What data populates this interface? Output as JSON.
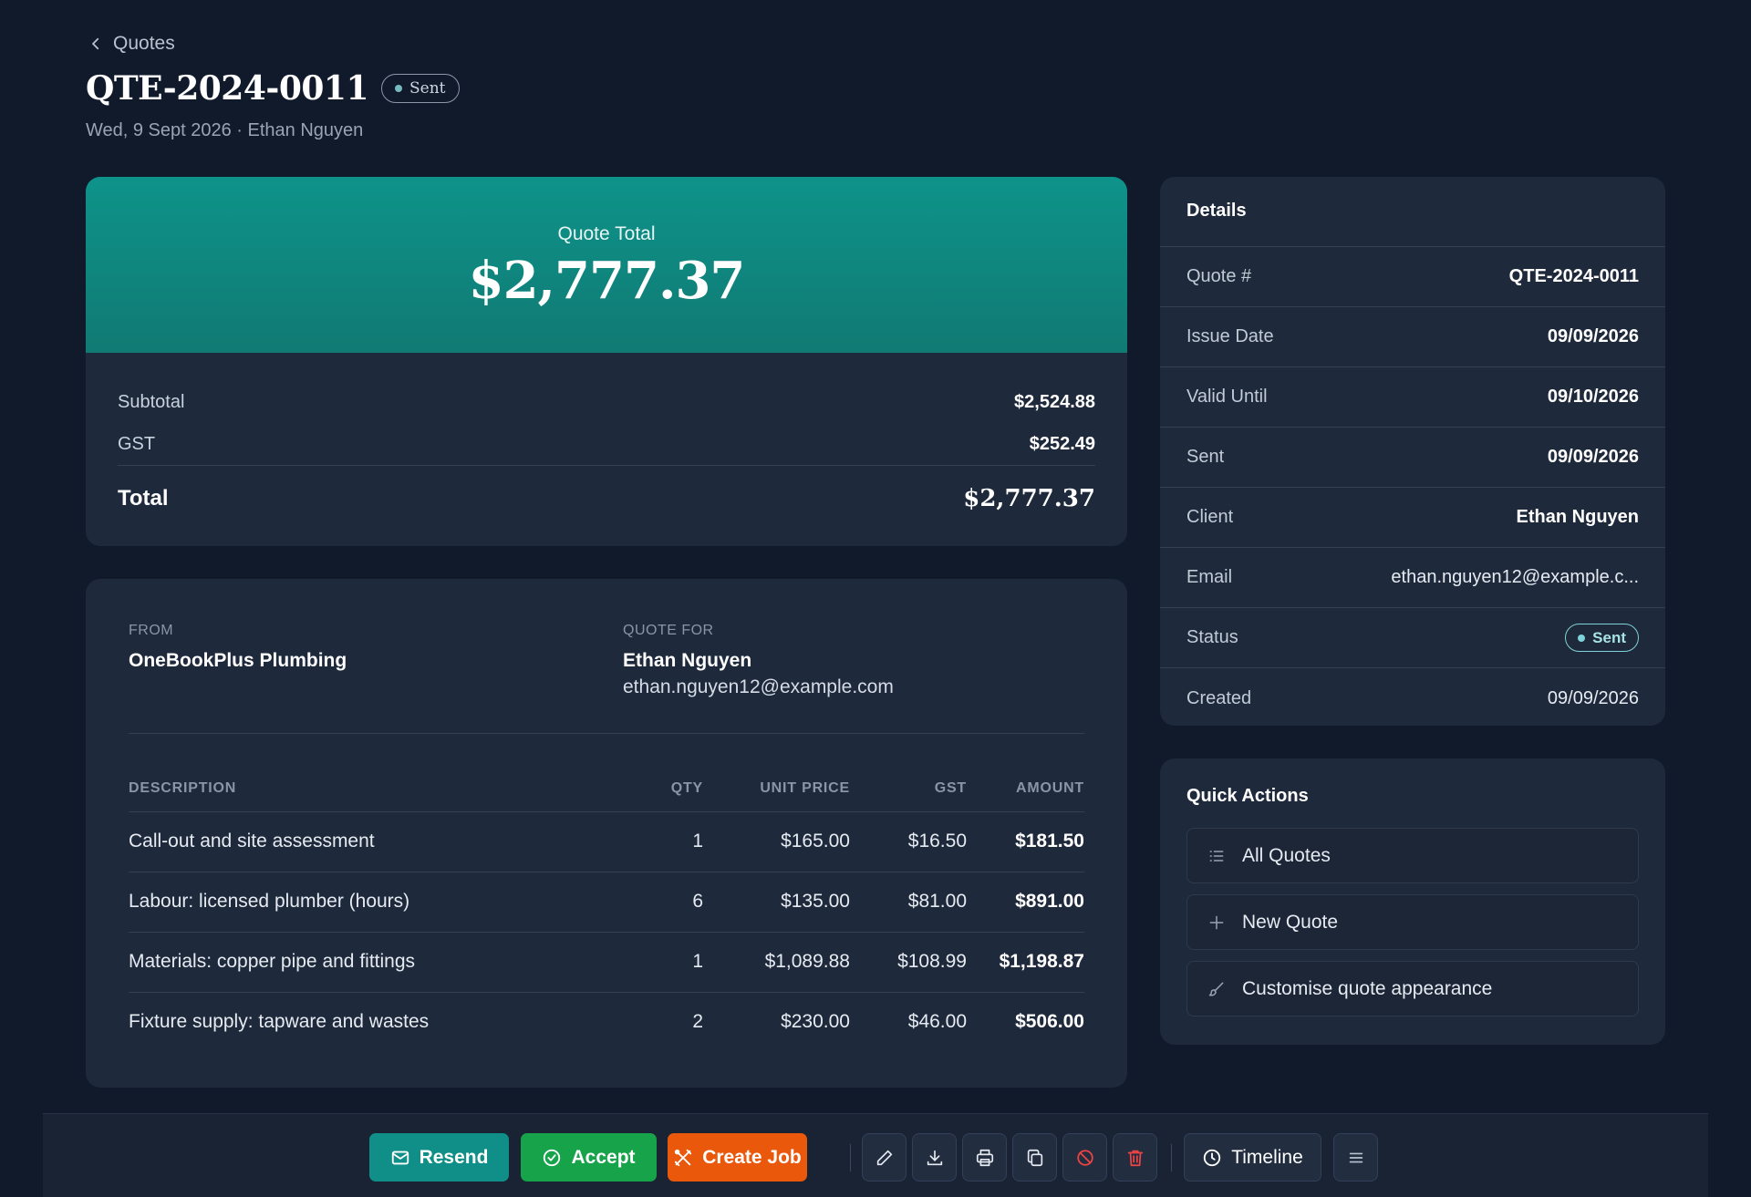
{
  "header": {
    "back_label": "Quotes",
    "title": "QTE-2024-0011",
    "status_badge": "Sent",
    "subtitle": "Wed, 9 Sept 2026 · Ethan Nguyen"
  },
  "total_card": {
    "label": "Quote Total",
    "amount": "$2,777.37",
    "subtotal_label": "Subtotal",
    "subtotal_value": "$2,524.88",
    "gst_label": "GST",
    "gst_value": "$252.49",
    "total_label": "Total",
    "total_value": "$2,777.37"
  },
  "parties": {
    "from_label": "FROM",
    "from_name": "OneBookPlus Plumbing",
    "for_label": "QUOTE FOR",
    "for_name": "Ethan Nguyen",
    "for_email": "ethan.nguyen12@example.com"
  },
  "line_items": {
    "headers": {
      "description": "DESCRIPTION",
      "qty": "QTY",
      "unit_price": "UNIT PRICE",
      "gst": "GST",
      "amount": "AMOUNT"
    },
    "rows": [
      {
        "description": "Call-out and site assessment",
        "qty": "1",
        "unit_price": "$165.00",
        "gst": "$16.50",
        "amount": "$181.50"
      },
      {
        "description": "Labour: licensed plumber (hours)",
        "qty": "6",
        "unit_price": "$135.00",
        "gst": "$81.00",
        "amount": "$891.00"
      },
      {
        "description": "Materials: copper pipe and fittings",
        "qty": "1",
        "unit_price": "$1,089.88",
        "gst": "$108.99",
        "amount": "$1,198.87"
      },
      {
        "description": "Fixture supply: tapware and wastes",
        "qty": "2",
        "unit_price": "$230.00",
        "gst": "$46.00",
        "amount": "$506.00"
      }
    ]
  },
  "details": {
    "title": "Details",
    "rows": [
      {
        "label": "Quote #",
        "value": "QTE-2024-0011"
      },
      {
        "label": "Issue Date",
        "value": "09/09/2026"
      },
      {
        "label": "Valid Until",
        "value": "09/10/2026"
      },
      {
        "label": "Sent",
        "value": "09/09/2026"
      },
      {
        "label": "Client",
        "value": "Ethan Nguyen"
      },
      {
        "label": "Email",
        "value": "ethan.nguyen12@example.c..."
      },
      {
        "label": "Status",
        "value": "Sent"
      },
      {
        "label": "Created",
        "value": "09/09/2026"
      }
    ]
  },
  "quick_actions": {
    "title": "Quick Actions",
    "items": [
      {
        "label": "All Quotes",
        "icon": "list-icon"
      },
      {
        "label": "New Quote",
        "icon": "plus-icon"
      },
      {
        "label": "Customise quote appearance",
        "icon": "brush-icon"
      }
    ]
  },
  "toolbar": {
    "resend_label": "Resend",
    "accept_label": "Accept",
    "create_job_label": "Create Job",
    "timeline_label": "Timeline",
    "icons": [
      "pencil-icon",
      "download-icon",
      "printer-icon",
      "copy-icon",
      "ban-icon",
      "trash-icon",
      "clock-icon",
      "menu-icon"
    ]
  },
  "colors": {
    "background": "#111a2b",
    "card": "#1e293b",
    "teal": "#0f8f87",
    "green": "#16a34a",
    "orange": "#ea580c",
    "danger": "#ef4444"
  }
}
